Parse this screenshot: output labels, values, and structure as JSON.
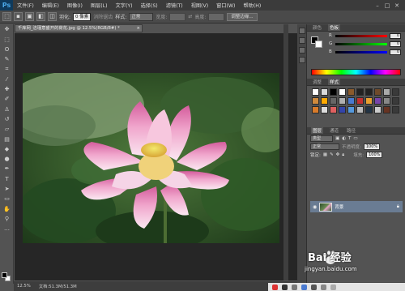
{
  "app": {
    "logo": "Ps"
  },
  "menu": {
    "items": [
      "文件(F)",
      "编辑(E)",
      "图像(I)",
      "图层(L)",
      "文字(Y)",
      "选择(S)",
      "滤镜(T)",
      "视图(V)",
      "窗口(W)",
      "帮助(H)"
    ]
  },
  "options": {
    "feather_label": "羽化:",
    "feather_value": "0 像素",
    "antialias_label": "消除锯齿",
    "style_label": "样式:",
    "style_value": "正常",
    "width_label": "宽度:",
    "height_label": "高度:",
    "refine_button": "调整边缘..."
  },
  "document": {
    "tab_title": "千库网_洁瑾意盛开的荷花.jpg @ 12.5%(RGB/8#) *",
    "close": "×",
    "zoom": "12.5%",
    "doc_info": "文档:51.3M/51.3M"
  },
  "panels": {
    "color": {
      "tab_inactive": "颜色",
      "tab_active": "色板",
      "r_label": "R",
      "g_label": "G",
      "b_label": "B",
      "r_value": "0",
      "g_value": "0",
      "b_value": "0"
    },
    "adjust": {
      "tab_inactive": "调整",
      "tab_active": "样式"
    },
    "layers": {
      "tabs": [
        "图层",
        "通道",
        "路径"
      ],
      "filter_label": "类型",
      "blend_mode": "正常",
      "opacity_label": "不透明度:",
      "opacity_value": "100%",
      "lock_label": "锁定:",
      "fill_label": "填充:",
      "fill_value": "100%",
      "layer_name": "背景"
    }
  },
  "watermark": {
    "brand": "Bai 经验",
    "url": "jingyan.baidu.com"
  },
  "colors": {
    "menubar": "#3b3b3b",
    "panel": "#535353",
    "workspace": "#262626",
    "layer_selected": "#6a7c93",
    "swatch_row1": [
      "#ffffff",
      "#d9d9d9",
      "#000000",
      "#ffffff",
      "#8b5a2b",
      "#222222",
      "#222222",
      "#6f4a2a",
      "#aaaaaa",
      "#3a3a3a"
    ],
    "swatch_row2": [
      "#d08a3c",
      "#ffaa00",
      "#666666",
      "#b0b0b0",
      "#4a7ad0",
      "#c33030",
      "#e8a030",
      "#7744aa",
      "#888888",
      "#3a3a3a"
    ],
    "swatch_row3": [
      "#d87b2a",
      "#dddddd",
      "#e06060",
      "#3344aa",
      "#5599dd",
      "#bbbbbb",
      "#223344",
      "#cccccc",
      "#663322",
      "#3a3a3a"
    ]
  }
}
